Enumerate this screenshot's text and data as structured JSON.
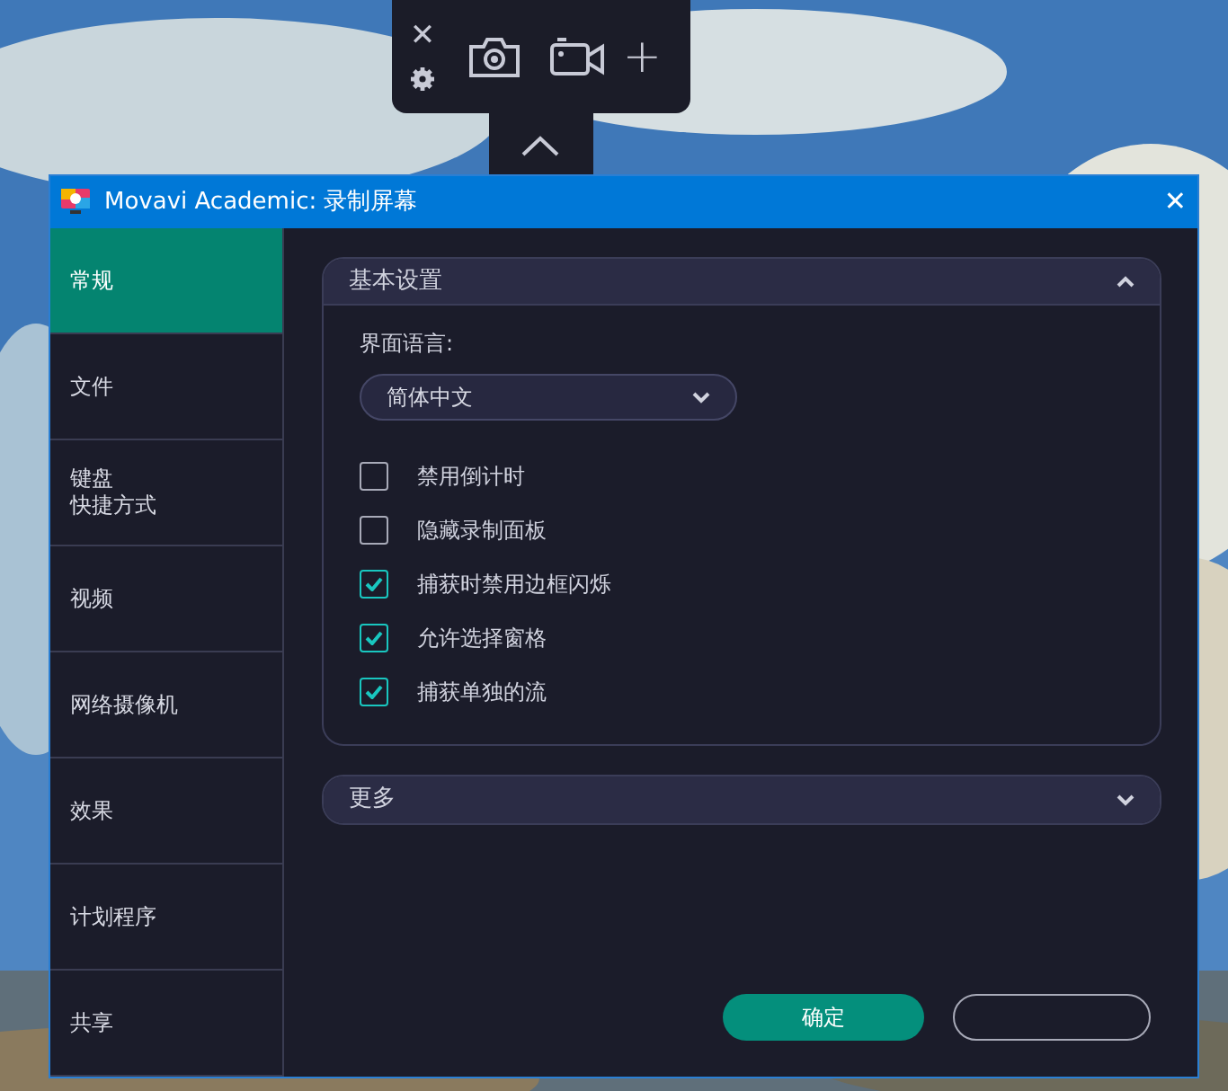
{
  "toolbar": {
    "close": "✕",
    "add": "+"
  },
  "window": {
    "title": "Movavi Academic: 录制屏幕",
    "close": "✕"
  },
  "sidebar": {
    "items": [
      {
        "label": "常规",
        "selected": true
      },
      {
        "label": "文件",
        "selected": false
      },
      {
        "lines": [
          "键盘",
          "快捷方式"
        ],
        "selected": false
      },
      {
        "label": "视频",
        "selected": false
      },
      {
        "label": "网络摄像机",
        "selected": false
      },
      {
        "label": "效果",
        "selected": false
      },
      {
        "label": "计划程序",
        "selected": false
      },
      {
        "label": "共享",
        "selected": false
      }
    ]
  },
  "sections": [
    {
      "title": "基本设置",
      "expanded": true,
      "language_label": "界面语言:",
      "language": "简体中文",
      "options": [
        {
          "label": "禁用倒计时",
          "checked": false
        },
        {
          "label": "隐藏录制面板",
          "checked": false
        },
        {
          "label": "捕获时禁用边框闪烁",
          "checked": true
        },
        {
          "label": "允许选择窗格",
          "checked": true
        },
        {
          "label": "捕获单独的流",
          "checked": true
        }
      ]
    },
    {
      "title": "更多",
      "expanded": false
    }
  ],
  "buttons": [
    {
      "label": "确定",
      "kind": "primary"
    },
    {
      "kind": "outline"
    }
  ]
}
